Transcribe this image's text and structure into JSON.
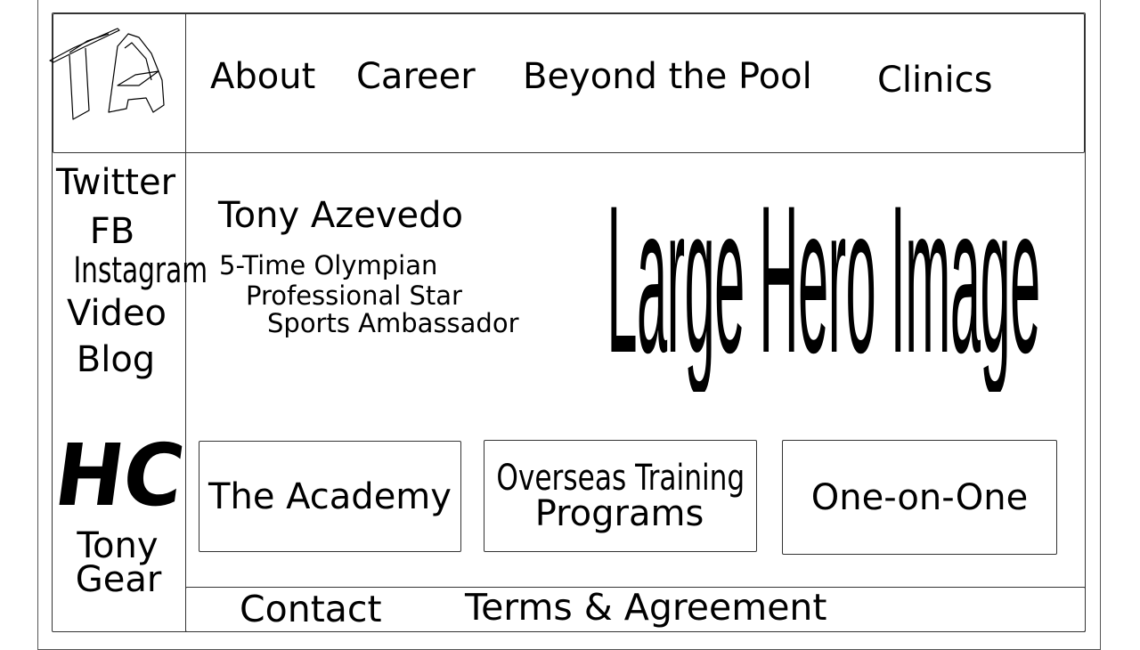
{
  "logo": {
    "text": "TA"
  },
  "nav": {
    "items": [
      {
        "label": "About"
      },
      {
        "label": "Career"
      },
      {
        "label": "Beyond the Pool"
      },
      {
        "label": "Clinics"
      }
    ]
  },
  "sidebar": {
    "links": [
      {
        "label": "Twitter"
      },
      {
        "label": "FB"
      },
      {
        "label": "Instagram"
      },
      {
        "label": "Video"
      },
      {
        "label": "Blog"
      }
    ],
    "brand_logo": "HC",
    "gear_line1": "Tony",
    "gear_line2": "Gear"
  },
  "profile": {
    "name": "Tony Azevedo",
    "taglines": [
      "5-Time Olympian",
      "Professional Star",
      "Sports Ambassador"
    ]
  },
  "hero": {
    "placeholder": "Large Hero Image"
  },
  "cards": [
    {
      "lines": [
        "The Academy"
      ]
    },
    {
      "lines": [
        "Overseas Training",
        "Programs"
      ]
    },
    {
      "lines": [
        "One-on-One"
      ]
    }
  ],
  "footer": {
    "links": [
      {
        "label": "Contact"
      },
      {
        "label": "Terms & Agreement"
      }
    ]
  }
}
